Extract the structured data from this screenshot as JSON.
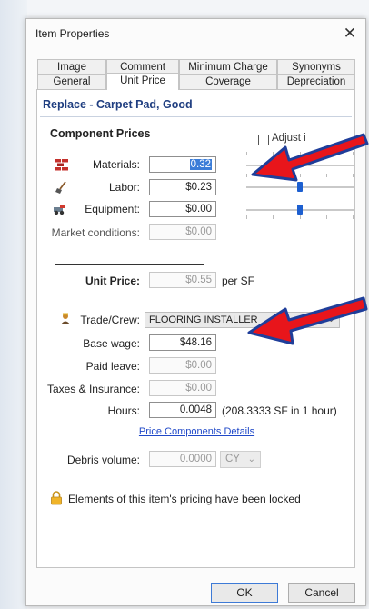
{
  "dialog": {
    "title": "Item Properties",
    "close_glyph": "✕"
  },
  "tabs": {
    "row1": [
      "Image",
      "Comment",
      "Minimum Charge",
      "Synonyms"
    ],
    "row2": [
      "General",
      "Unit Price",
      "Coverage",
      "Depreciation"
    ],
    "active": "Unit Price"
  },
  "item_name": "Replace - Carpet Pad, Good",
  "component_prices": {
    "heading": "Component Prices",
    "adjust_label": "Adjust i",
    "materials": {
      "label": "Materials:",
      "value": "0.32",
      "icon": "bricks-icon"
    },
    "labor": {
      "label": "Labor:",
      "value": "$0.23",
      "icon": "shovel-icon"
    },
    "equipment": {
      "label": "Equipment:",
      "value": "$0.00",
      "icon": "equipment-icon"
    },
    "market": {
      "label": "Market conditions:",
      "value": "$0.00"
    }
  },
  "sliders": {
    "labor_level": 0.5,
    "equipment_level": 0.5
  },
  "unit_price": {
    "label": "Unit Price:",
    "value": "$0.55",
    "unit": "per SF"
  },
  "trade": {
    "label": "Trade/Crew:",
    "value": "FLOORING INSTALLER",
    "icon": "worker-icon",
    "base_wage": {
      "label": "Base wage:",
      "value": "$48.16"
    },
    "paid_leave": {
      "label": "Paid leave:",
      "value": "$0.00"
    },
    "taxes": {
      "label": "Taxes & Insurance:",
      "value": "$0.00"
    },
    "hours": {
      "label": "Hours:",
      "value": "0.0048",
      "note": "(208.3333 SF in 1 hour)"
    }
  },
  "price_components_link": "Price Components Details",
  "debris": {
    "label": "Debris volume:",
    "value": "0.0000",
    "unit": "CY"
  },
  "lock_message": "Elements of this item's pricing have been locked",
  "buttons": {
    "ok": "OK",
    "cancel": "Cancel"
  },
  "colors": {
    "accent": "#1d5fd0",
    "annotation_arrow": "#e8151b",
    "annotation_outline": "#1f3e9a"
  }
}
